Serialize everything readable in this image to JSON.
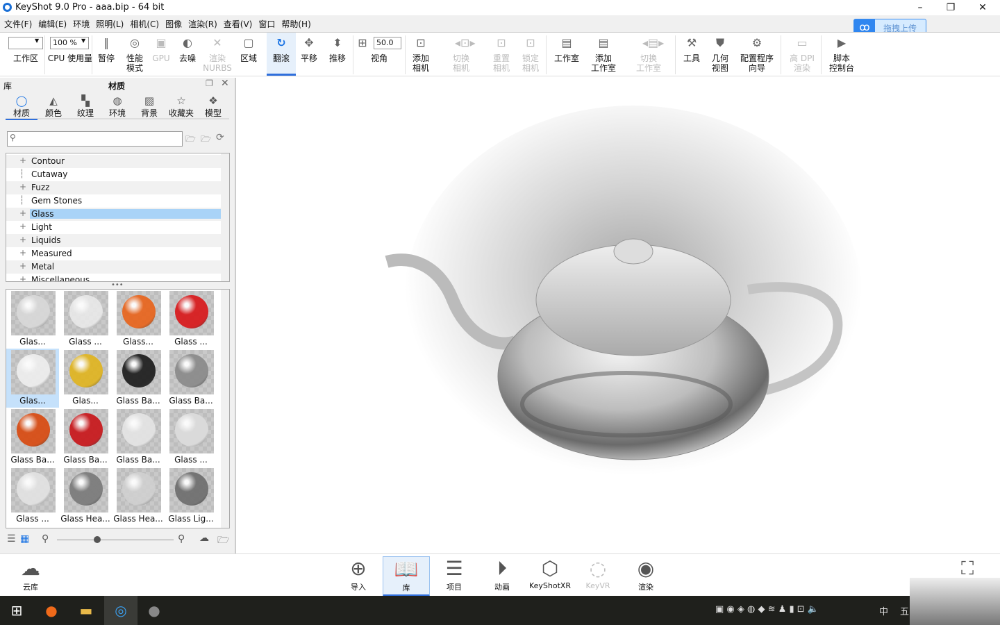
{
  "window": {
    "title": "KeyShot 9.0 Pro  - aaa.bip  - 64 bit",
    "minimize": "–",
    "maximize": "❐",
    "close": "✕"
  },
  "menu": [
    "文件(F)",
    "编辑(E)",
    "环境",
    "照明(L)",
    "相机(C)",
    "图像",
    "渲染(R)",
    "查看(V)",
    "窗口",
    "帮助(H)"
  ],
  "upload": {
    "label": "拖拽上传",
    "icon": "cloud-link-icon"
  },
  "toolbar": {
    "workspace_value": "",
    "cpu_value": "100 %",
    "fov_value": "50.0",
    "items": [
      {
        "label": "工作区",
        "icon": "",
        "state": "normal"
      },
      {
        "label": "CPU 使用量",
        "icon": "",
        "state": "normal"
      },
      {
        "label": "暂停",
        "icon": "pause-icon",
        "state": "normal"
      },
      {
        "label": "性能\n模式",
        "icon": "performance-icon",
        "state": "normal"
      },
      {
        "label": "GPU",
        "icon": "gpu-icon",
        "state": "disabled"
      },
      {
        "label": "去噪",
        "icon": "denoise-icon",
        "state": "normal"
      },
      {
        "label": "渲染\nNURBS",
        "icon": "nurbs-icon",
        "state": "disabled"
      },
      {
        "label": "区域",
        "icon": "region-icon",
        "state": "normal"
      },
      {
        "label": "翻滚",
        "icon": "tumble-icon",
        "state": "active"
      },
      {
        "label": "平移",
        "icon": "pan-icon",
        "state": "normal"
      },
      {
        "label": "推移",
        "icon": "dolly-icon",
        "state": "normal"
      },
      {
        "label": "视角",
        "icon": "fov-icon",
        "state": "normal"
      },
      {
        "label": "添加\n相机",
        "icon": "add-camera-icon",
        "state": "normal"
      },
      {
        "label": "切换\n相机",
        "icon": "switch-camera-icon",
        "state": "disabled"
      },
      {
        "label": "重置\n相机",
        "icon": "reset-camera-icon",
        "state": "disabled"
      },
      {
        "label": "锁定\n相机",
        "icon": "lock-camera-icon",
        "state": "disabled"
      },
      {
        "label": "工作室",
        "icon": "studio-icon",
        "state": "normal"
      },
      {
        "label": "添加\n工作室",
        "icon": "add-studio-icon",
        "state": "normal"
      },
      {
        "label": "切换\n工作室",
        "icon": "switch-studio-icon",
        "state": "disabled"
      },
      {
        "label": "工具",
        "icon": "tools-icon",
        "state": "normal"
      },
      {
        "label": "几何\n视图",
        "icon": "geometry-view-icon",
        "state": "normal"
      },
      {
        "label": "配置程序\n向导",
        "icon": "configurator-icon",
        "state": "normal"
      },
      {
        "label": "高 DPI\n渲染",
        "icon": "hidpi-icon",
        "state": "disabled"
      },
      {
        "label": "脚本\n控制台",
        "icon": "script-console-icon",
        "state": "normal"
      }
    ]
  },
  "library": {
    "header_left": "库",
    "title": "材质",
    "tabs": [
      {
        "label": "材质",
        "icon": "material-icon"
      },
      {
        "label": "颜色",
        "icon": "color-icon"
      },
      {
        "label": "纹理",
        "icon": "texture-icon"
      },
      {
        "label": "环境",
        "icon": "environment-icon"
      },
      {
        "label": "背景",
        "icon": "background-icon"
      },
      {
        "label": "收藏夹",
        "icon": "favorites-icon"
      },
      {
        "label": "模型",
        "icon": "model-icon"
      }
    ],
    "search_placeholder": "",
    "tree": [
      {
        "label": "Contour",
        "expandable": true
      },
      {
        "label": "Cutaway",
        "expandable": false
      },
      {
        "label": "Fuzz",
        "expandable": true
      },
      {
        "label": "Gem Stones",
        "expandable": false
      },
      {
        "label": "Glass",
        "expandable": true,
        "selected": true
      },
      {
        "label": "Light",
        "expandable": true
      },
      {
        "label": "Liquids",
        "expandable": true
      },
      {
        "label": "Measured",
        "expandable": true
      },
      {
        "label": "Metal",
        "expandable": true
      },
      {
        "label": "Miscellaneous",
        "expandable": true
      }
    ],
    "materials": [
      {
        "label": "Glas...",
        "color": "#d8d8d8"
      },
      {
        "label": "Glass ...",
        "color": "#e8e8e8"
      },
      {
        "label": "Glass...",
        "color": "#e8641c"
      },
      {
        "label": "Glass ...",
        "color": "#d8181a"
      },
      {
        "label": "Glas...",
        "color": "#eeeeee",
        "selected": true
      },
      {
        "label": "Glas...",
        "color": "#e0b420"
      },
      {
        "label": "Glass Ba...",
        "color": "#1c1c1c"
      },
      {
        "label": "Glass Ba...",
        "color": "#8a8a8a"
      },
      {
        "label": "Glass Ba...",
        "color": "#d84a10"
      },
      {
        "label": "Glass Ba...",
        "color": "#c8161a"
      },
      {
        "label": "Glass Ba...",
        "color": "#e4e4e4"
      },
      {
        "label": "Glass ...",
        "color": "#dcdcdc"
      },
      {
        "label": "Glass ...",
        "color": "#e2e2e2"
      },
      {
        "label": "Glass Hea...",
        "color": "#7a7a7a"
      },
      {
        "label": "Glass Hea...",
        "color": "#d0d0d0"
      },
      {
        "label": "Glass Lig...",
        "color": "#6e6e6e"
      }
    ]
  },
  "bottombar": {
    "cloud_label": "云库",
    "items": [
      {
        "label": "导入",
        "icon": "import-icon",
        "state": "normal"
      },
      {
        "label": "库",
        "icon": "library-book-icon",
        "state": "active"
      },
      {
        "label": "项目",
        "icon": "project-icon",
        "state": "normal"
      },
      {
        "label": "动画",
        "icon": "animation-icon",
        "state": "normal"
      },
      {
        "label": "KeyShotXR",
        "icon": "keyshotxr-icon",
        "state": "normal"
      },
      {
        "label": "KeyVR",
        "icon": "keyvr-icon",
        "state": "disabled"
      },
      {
        "label": "渲染",
        "icon": "render-icon",
        "state": "normal"
      }
    ]
  },
  "taskbar": {
    "tray_ime": "中",
    "tray_extra": "五"
  },
  "colors": {
    "accent": "#2f6fdc",
    "selection": "#a9d3f7"
  }
}
